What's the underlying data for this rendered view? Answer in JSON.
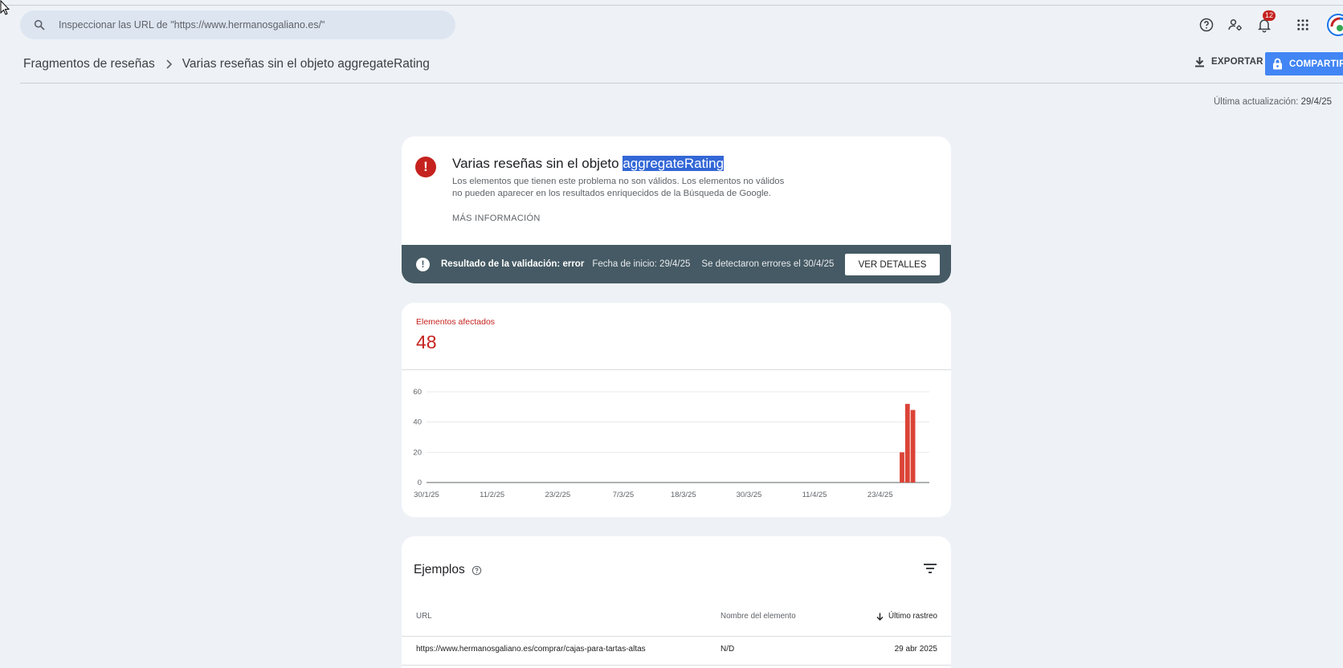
{
  "search": {
    "placeholder": "Inspeccionar las URL de \"https://www.hermanosgaliano.es/\""
  },
  "topbar": {
    "notifications_count": "12"
  },
  "breadcrumb": {
    "parent": "Fragmentos de reseñas",
    "current": "Varias reseñas sin el objeto aggregateRating"
  },
  "actions": {
    "export_label": "EXPORTAR",
    "share_label": "COMPARTIR"
  },
  "last_update": {
    "label": "Última actualización:",
    "value": "29/4/25"
  },
  "issue": {
    "title_prefix": "Varias reseñas sin el objeto ",
    "title_highlight": "aggregateRating",
    "desc_line1": "Los elementos que tienen este problema no son válidos. Los elementos no válidos",
    "desc_line2": "no pueden aparecer en los resultados enriquecidos de la Búsqueda de Google.",
    "more_info": "MÁS INFORMACIÓN"
  },
  "validation": {
    "label": "Resultado de la validación: error",
    "start": "Fecha de inicio: 29/4/25",
    "errors": "Se detectaron errores el 30/4/25",
    "details_button": "VER DETALLES"
  },
  "affected": {
    "label": "Elementos afectados",
    "count": "48"
  },
  "chart_data": {
    "type": "bar",
    "ylim": [
      0,
      60
    ],
    "yticks": [
      "0",
      "20",
      "40",
      "60"
    ],
    "xticks": [
      "30/1/25",
      "11/2/25",
      "23/2/25",
      "7/3/25",
      "18/3/25",
      "30/3/25",
      "11/4/25",
      "23/4/25"
    ],
    "x_start": "2025-01-30",
    "x_end": "2025-05-02",
    "categories": [
      "27/4/25",
      "28/4/25",
      "29/4/25"
    ],
    "values": [
      20,
      52,
      48
    ],
    "color": "#db4437"
  },
  "examples": {
    "title": "Ejemplos",
    "columns": {
      "url": "URL",
      "name": "Nombre del elemento",
      "date": "Último rastreo"
    },
    "rows": [
      {
        "url": "https://www.hermanosgaliano.es/comprar/cajas-para-tartas-altas",
        "name": "N/D",
        "date": "29 abr 2025"
      }
    ]
  }
}
